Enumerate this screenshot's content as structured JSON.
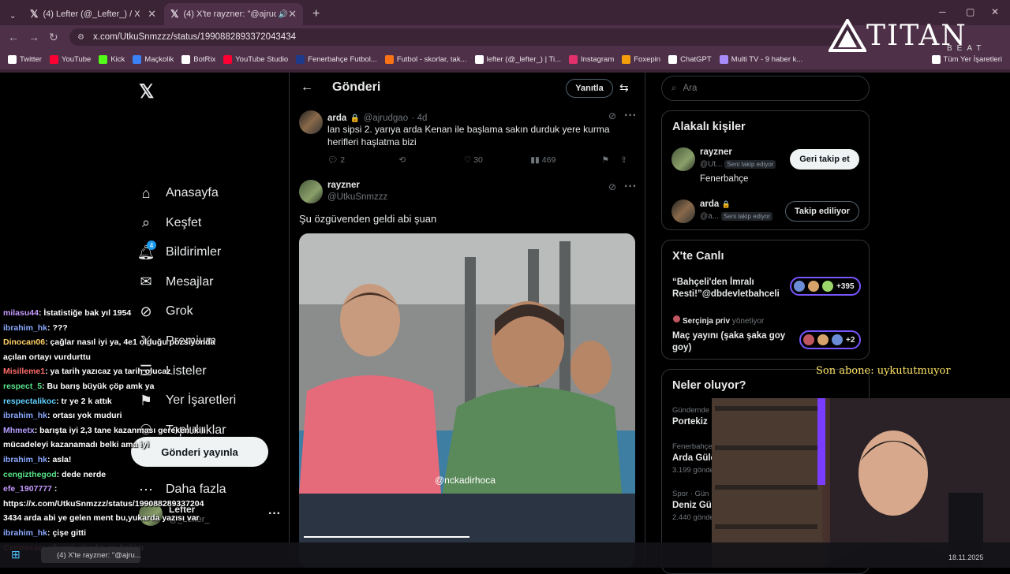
{
  "browser": {
    "tabs": [
      {
        "label": "(4) Lefter (@_Lefter_) / X",
        "active": false
      },
      {
        "label": "(4) X'te rayzner: \"@ajrudgao",
        "active": true
      }
    ],
    "url": "x.com/UtkuSnmzzz/status/1990882893372043434",
    "bookmarks": [
      "Twitter",
      "YouTube",
      "Kick",
      "Maçkolik",
      "BotRix",
      "YouTube Studio",
      "Fenerbahçe Futbol...",
      "Futbol - skorlar, tak...",
      "lefter (@_lefter_) | Ti...",
      "Instagram",
      "Foxepin",
      "ChatGPT",
      "Multi TV - 9 haber k...",
      "Tüm Yer İşaretleri"
    ],
    "bookmark_colors": [
      "#ffffff",
      "#ff0033",
      "#53fc18",
      "#3b82f6",
      "#ffffff",
      "#ff0033",
      "#1e3a8a",
      "#f97316",
      "#ffffff",
      "#e1306c",
      "#f59e0b",
      "#ffffff",
      "#a78bfa",
      "#ffffff"
    ]
  },
  "overlay": {
    "brand": "TITAN",
    "brand_sub": "BEAT",
    "son_abone": "Son abone: uykututmuyor"
  },
  "nav": {
    "items": [
      {
        "label": "Anasayfa",
        "icon": "home-icon"
      },
      {
        "label": "Keşfet",
        "icon": "search-icon"
      },
      {
        "label": "Bildirimler",
        "icon": "bell-icon",
        "badge": "4"
      },
      {
        "label": "Mesajlar",
        "icon": "mail-icon"
      },
      {
        "label": "Grok",
        "icon": "grok-icon"
      },
      {
        "label": "Premium",
        "icon": "x-icon"
      },
      {
        "label": "Listeler",
        "icon": "list-icon"
      },
      {
        "label": "Yer İşaretleri",
        "icon": "bookmark-icon"
      },
      {
        "label": "Topluluklar",
        "icon": "people-icon"
      },
      {
        "label": "Profil",
        "icon": "person-icon"
      },
      {
        "label": "Daha fazla",
        "icon": "more-icon"
      }
    ],
    "post_button": "Gönderi yayınla",
    "profile_name": "Lefter",
    "profile_handle": "@_Lefter_"
  },
  "main": {
    "header_title": "Gönderi",
    "reply_label": "Yanıtla",
    "parent": {
      "name": "arda",
      "handle": "@ajrudgao",
      "time": "· 4d",
      "text": "lan sipsi 2. yarıya arda Kenan ile başlama sakın durduk yere kurma herifleri haşlatma bizi",
      "replies": "2",
      "likes": "30",
      "views": "469"
    },
    "post": {
      "name": "rayzner",
      "handle": "@UtkuSnmzzz",
      "text": "Şu özgüvenden geldi abi şuan",
      "media_watermark": "@nckadirhoca"
    }
  },
  "right": {
    "search_placeholder": "Ara",
    "related_title": "Alakalı kişiler",
    "people": [
      {
        "name": "rayzner",
        "handle": "@Ut...",
        "tag": "Seni takip ediyor",
        "bio": "Fenerbahçe",
        "button": "Geri takip et"
      },
      {
        "name": "arda",
        "handle": "@a...",
        "tag": "Seni takip ediyor",
        "bio": "",
        "button": "Takip ediliyor"
      }
    ],
    "live_title": "X'te Canlı",
    "live": [
      {
        "host": "",
        "host_suffix": "",
        "title": "“Bahçeli'den İmralı Resti!”@dbdevletbahceli",
        "count": "+395"
      },
      {
        "host": "Serçinja priv",
        "host_suffix": "yönetiyor",
        "title": "Maç yayını (şaka şaka goy goy)",
        "count": "+2"
      }
    ],
    "trends_title": "Neler oluyor?",
    "trends": [
      {
        "category": "Gündemde",
        "name": "Portekiz",
        "count": ""
      },
      {
        "category": "Fenerbahçe",
        "name": "Arda Güle",
        "count": "3.199 gönde"
      },
      {
        "category": "Spor · Gün",
        "name": "Deniz Gül",
        "count": "2.440 gönde"
      }
    ]
  },
  "chat": [
    {
      "user": "milasu44",
      "color": "#c59bff",
      "msg": ": İstatistiğe bak yıl 1954"
    },
    {
      "user": "ibrahim_hk",
      "color": "#8aa9ff",
      "msg": ": ???"
    },
    {
      "user": "Dinocan06",
      "color": "#ffd166",
      "msg": ": çağlar nasıl iyi ya, 4e1 olduğu pozsiyonda"
    },
    {
      "user": "",
      "color": "#ffffff",
      "msg": "açılan ortayı vurdurttu"
    },
    {
      "user": "Misilleme1",
      "color": "#ff6b6b",
      "msg": ": ya tarih yazıcaz ya tarih olucaz"
    },
    {
      "user": "respect_5",
      "color": "#57e389",
      "msg": ": Bu barış büyük çöp amk ya"
    },
    {
      "user": "respectalikoc",
      "color": "#62d0ff",
      "msg": ": tr ye 2 k attık"
    },
    {
      "user": "ibrahim_hk",
      "color": "#8aa9ff",
      "msg": ": ortası yok muduri"
    },
    {
      "user": "Mhmetx",
      "color": "#b39dff",
      "msg": ": barışta iyi 2,3 tane kazanması gereken ikili"
    },
    {
      "user": "",
      "color": "#ffffff",
      "msg": "mücadeleyi kazanamadı belki ama iyi"
    },
    {
      "user": "ibrahim_hk",
      "color": "#8aa9ff",
      "msg": ": asla!"
    },
    {
      "user": "cengizthegod",
      "color": "#57e389",
      "msg": ": dede nerde"
    },
    {
      "user": "efe_1907777",
      "color": "#c59bff",
      "msg": " :"
    },
    {
      "user": "",
      "color": "#ffffff",
      "msg": "https://x.com/UtkuSnmzzz/status/199088289337204"
    },
    {
      "user": "",
      "color": "#ffffff",
      "msg": "3434 arda abi ye gelen ment bu,yukarda yazısı var"
    },
    {
      "user": "ibrahim_hk",
      "color": "#8aa9ff",
      "msg": ": çişe gitti"
    },
    {
      "user": "Cemresse",
      "color": "#ff6b6b",
      "msg": ": ellerini yıkadın mı bakim"
    }
  ],
  "taskbar": {
    "tab_label": "(4) X'te rayzner: \"@ajru...",
    "date": "18.11.2025"
  }
}
